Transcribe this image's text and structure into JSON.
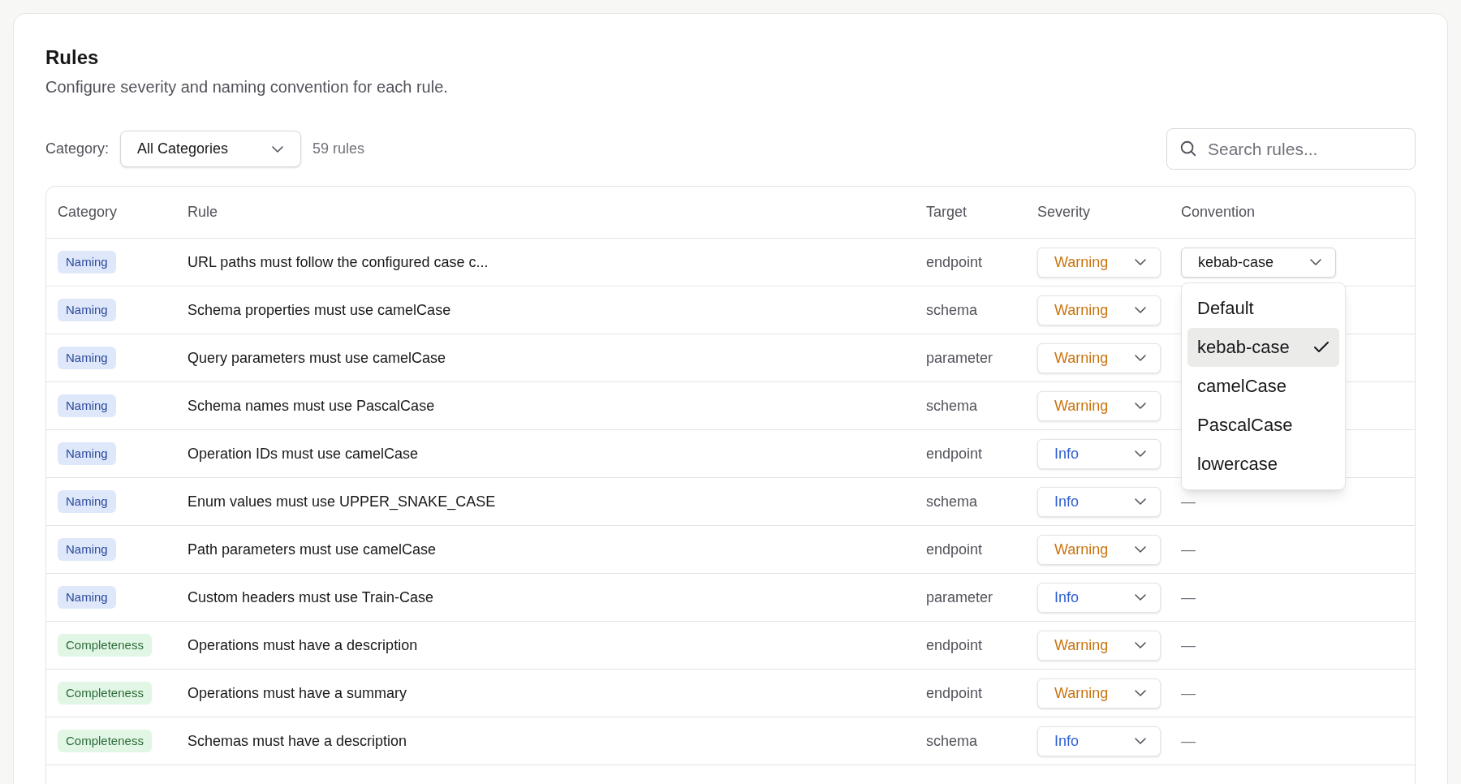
{
  "header": {
    "title": "Rules",
    "subtitle": "Configure severity and naming convention for each rule."
  },
  "filter": {
    "label": "Category:",
    "value": "All Categories",
    "count": "59 rules"
  },
  "search": {
    "placeholder": "Search rules..."
  },
  "table": {
    "columns": [
      "Category",
      "Rule",
      "Target",
      "Severity",
      "Convention"
    ],
    "rows": [
      {
        "category": {
          "label": "Naming",
          "kind": "naming"
        },
        "rule": "URL paths must follow the configured case c...",
        "target": "endpoint",
        "severity": {
          "label": "Warning",
          "kind": "warning"
        },
        "convention": {
          "kind": "select",
          "value": "kebab-case",
          "expanded": true
        }
      },
      {
        "category": {
          "label": "Naming",
          "kind": "naming"
        },
        "rule": "Schema properties must use camelCase",
        "target": "schema",
        "severity": {
          "label": "Warning",
          "kind": "warning"
        }
      },
      {
        "category": {
          "label": "Naming",
          "kind": "naming"
        },
        "rule": "Query parameters must use camelCase",
        "target": "parameter",
        "severity": {
          "label": "Warning",
          "kind": "warning"
        }
      },
      {
        "category": {
          "label": "Naming",
          "kind": "naming"
        },
        "rule": "Schema names must use PascalCase",
        "target": "schema",
        "severity": {
          "label": "Warning",
          "kind": "warning"
        }
      },
      {
        "category": {
          "label": "Naming",
          "kind": "naming"
        },
        "rule": "Operation IDs must use camelCase",
        "target": "endpoint",
        "severity": {
          "label": "Info",
          "kind": "info"
        }
      },
      {
        "category": {
          "label": "Naming",
          "kind": "naming"
        },
        "rule": "Enum values must use UPPER_SNAKE_CASE",
        "target": "schema",
        "severity": {
          "label": "Info",
          "kind": "info"
        },
        "convention": {
          "kind": "none",
          "value": "—"
        }
      },
      {
        "category": {
          "label": "Naming",
          "kind": "naming"
        },
        "rule": "Path parameters must use camelCase",
        "target": "endpoint",
        "severity": {
          "label": "Warning",
          "kind": "warning"
        },
        "convention": {
          "kind": "none",
          "value": "—"
        }
      },
      {
        "category": {
          "label": "Naming",
          "kind": "naming"
        },
        "rule": "Custom headers must use Train-Case",
        "target": "parameter",
        "severity": {
          "label": "Info",
          "kind": "info"
        },
        "convention": {
          "kind": "none",
          "value": "—"
        }
      },
      {
        "category": {
          "label": "Completeness",
          "kind": "completeness"
        },
        "rule": "Operations must have a description",
        "target": "endpoint",
        "severity": {
          "label": "Warning",
          "kind": "warning"
        },
        "convention": {
          "kind": "none",
          "value": "—"
        }
      },
      {
        "category": {
          "label": "Completeness",
          "kind": "completeness"
        },
        "rule": "Operations must have a summary",
        "target": "endpoint",
        "severity": {
          "label": "Warning",
          "kind": "warning"
        },
        "convention": {
          "kind": "none",
          "value": "—"
        }
      },
      {
        "category": {
          "label": "Completeness",
          "kind": "completeness"
        },
        "rule": "Schemas must have a description",
        "target": "schema",
        "severity": {
          "label": "Info",
          "kind": "info"
        },
        "convention": {
          "kind": "none",
          "value": "—"
        }
      }
    ]
  },
  "convention_menu": {
    "items": [
      {
        "label": "Default",
        "selected": false
      },
      {
        "label": "kebab-case",
        "selected": true
      },
      {
        "label": "camelCase",
        "selected": false
      },
      {
        "label": "PascalCase",
        "selected": false
      },
      {
        "label": "lowercase",
        "selected": false
      }
    ]
  }
}
